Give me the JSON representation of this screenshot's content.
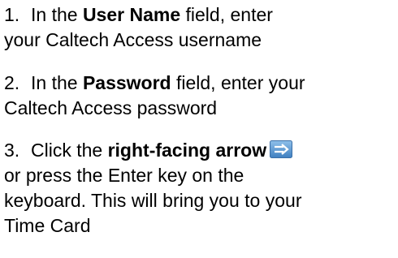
{
  "steps": [
    {
      "num": "1.",
      "pre": "In the ",
      "bold": "User Name",
      "post": " field, enter",
      "line2": "your Caltech Access username"
    },
    {
      "num": "2.",
      "pre": "In the ",
      "bold": "Password",
      "post": " field, enter your",
      "line2": "Caltech Access password"
    },
    {
      "num": "3.",
      "pre": "Click the ",
      "bold": "right-facing arrow",
      "icon": "right-arrow-icon",
      "line2": "or press the Enter key on the",
      "line3": "keyboard.  This will bring you to your",
      "line4": "Time Card"
    }
  ],
  "colors": {
    "text": "#000000",
    "arrow_bg": "#5b9bd5",
    "arrow_fg": "#ffffff"
  }
}
